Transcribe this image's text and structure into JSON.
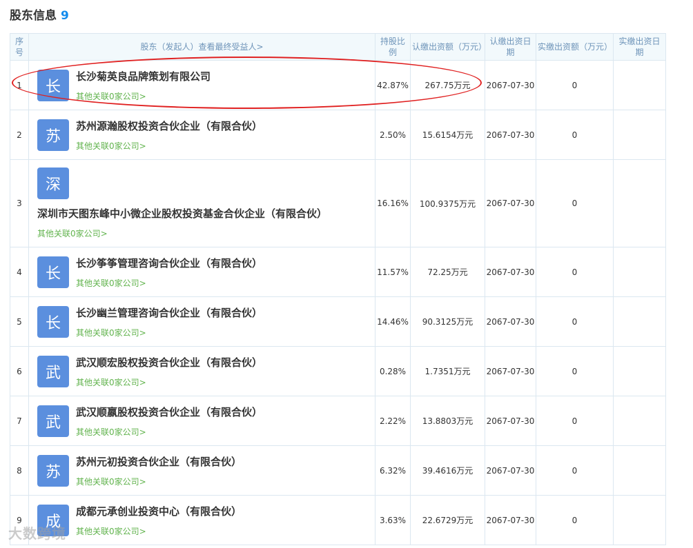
{
  "section": {
    "title": "股东信息",
    "count": "9"
  },
  "headers": {
    "index": "序号",
    "holder": "股东（发起人）查看最终受益人>",
    "ratio": "持股比例",
    "subscribed_amount": "认缴出资额（万元）",
    "subscribed_date": "认缴出资日期",
    "paid_amount": "实缴出资额（万元）",
    "paid_date": "实缴出资日期"
  },
  "rows": [
    {
      "index": "1",
      "avatar": "长",
      "name": "长沙菊英良品牌策划有限公司",
      "link": "其他关联0家公司>",
      "ratio": "42.87%",
      "amount": "267.75万元",
      "date": "2067-07-30",
      "paid": "0",
      "paid_date": ""
    },
    {
      "index": "2",
      "avatar": "苏",
      "name": "苏州源瀚股权投资合伙企业（有限合伙）",
      "link": "其他关联0家公司>",
      "ratio": "2.50%",
      "amount": "15.6154万元",
      "date": "2067-07-30",
      "paid": "0",
      "paid_date": ""
    },
    {
      "index": "3",
      "avatar": "深",
      "name": "深圳市天图东峰中小微企业股权投资基金合伙企业（有限合伙）",
      "link": "其他关联0家公司>",
      "ratio": "16.16%",
      "amount": "100.9375万元",
      "date": "2067-07-30",
      "paid": "0",
      "paid_date": ""
    },
    {
      "index": "4",
      "avatar": "长",
      "name": "长沙筝筝管理咨询合伙企业（有限合伙）",
      "link": "其他关联0家公司>",
      "ratio": "11.57%",
      "amount": "72.25万元",
      "date": "2067-07-30",
      "paid": "0",
      "paid_date": ""
    },
    {
      "index": "5",
      "avatar": "长",
      "name": "长沙幽兰管理咨询合伙企业（有限合伙）",
      "link": "其他关联0家公司>",
      "ratio": "14.46%",
      "amount": "90.3125万元",
      "date": "2067-07-30",
      "paid": "0",
      "paid_date": ""
    },
    {
      "index": "6",
      "avatar": "武",
      "name": "武汉顺宏股权投资合伙企业（有限合伙）",
      "link": "其他关联0家公司>",
      "ratio": "0.28%",
      "amount": "1.7351万元",
      "date": "2067-07-30",
      "paid": "0",
      "paid_date": ""
    },
    {
      "index": "7",
      "avatar": "武",
      "name": "武汉顺嬴股权投资合伙企业（有限合伙）",
      "link": "其他关联0家公司>",
      "ratio": "2.22%",
      "amount": "13.8803万元",
      "date": "2067-07-30",
      "paid": "0",
      "paid_date": ""
    },
    {
      "index": "8",
      "avatar": "苏",
      "name": "苏州元初投资合伙企业（有限合伙）",
      "link": "其他关联0家公司>",
      "ratio": "6.32%",
      "amount": "39.4616万元",
      "date": "2067-07-30",
      "paid": "0",
      "paid_date": ""
    },
    {
      "index": "9",
      "avatar": "成",
      "name": "成都元承创业投资中心（有限合伙）",
      "link": "其他关联0家公司>",
      "ratio": "3.63%",
      "amount": "22.6729万元",
      "date": "2067-07-30",
      "paid": "0",
      "paid_date": ""
    }
  ],
  "watermark": "大数跨境",
  "colors": {
    "accent": "#128bed",
    "avatar": "#5b8fde",
    "link": "#61b34d",
    "header_bg": "#f2f9fc",
    "highlight": "#e02020"
  }
}
